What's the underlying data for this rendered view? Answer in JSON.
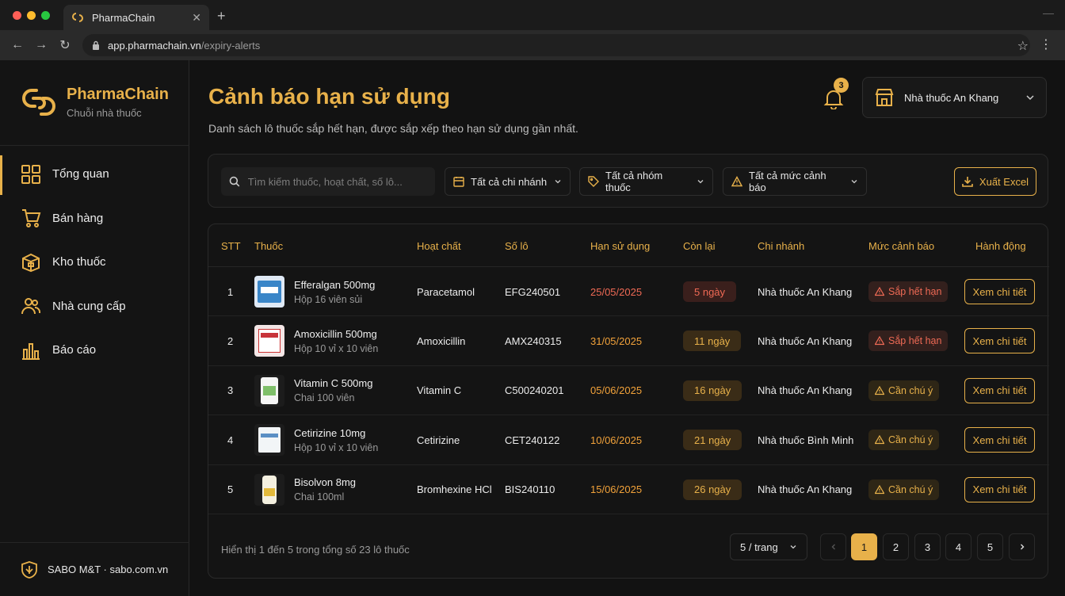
{
  "browser": {
    "tab_title": "PharmaChain",
    "url_host": "app.pharmachain.vn",
    "url_path": "/expiry-alerts"
  },
  "brand": {
    "name": "PharmaChain",
    "subtitle": "Chuỗi nhà thuốc"
  },
  "sidebar": {
    "items": [
      {
        "label": "Tổng quan",
        "icon": "grid-icon",
        "active": true
      },
      {
        "label": "Bán hàng",
        "icon": "cart-icon",
        "active": false
      },
      {
        "label": "Kho thuốc",
        "icon": "box-icon",
        "active": false
      },
      {
        "label": "Nhà cung cấp",
        "icon": "users-icon",
        "active": false
      },
      {
        "label": "Báo cáo",
        "icon": "bar-chart-icon",
        "active": false
      }
    ],
    "footer": "SABO M&T · sabo.com.vn"
  },
  "header": {
    "title": "Cảnh báo hạn sử dụng",
    "subtitle": "Danh sách lô thuốc sắp hết hạn, được sắp xếp theo hạn sử dụng gần nhất.",
    "notification_count": "3",
    "store": "Nhà thuốc An Khang"
  },
  "filters": {
    "search_placeholder": "Tìm kiếm thuốc, hoạt chất, số lô...",
    "branch": "Tất cả chi nhánh",
    "group": "Tất cả nhóm thuốc",
    "level": "Tất cả mức cảnh báo",
    "export": "Xuất Excel"
  },
  "table": {
    "columns": [
      "STT",
      "Thuốc",
      "Hoạt chất",
      "Số lô",
      "Hạn sử dụng",
      "Còn lại",
      "Chi nhánh",
      "Mức cảnh báo",
      "Hành động"
    ],
    "rows": [
      {
        "stt": "1",
        "name": "Efferalgan 500mg",
        "pack": "Hộp 16 viên sủi",
        "ingredient": "Paracetamol",
        "lot": "EFG240501",
        "expiry": "25/05/2025",
        "remaining": "5 ngày",
        "branch": "Nhà thuốc An Khang",
        "level": "Sắp hết hạn",
        "action": "Xem chi tiết"
      },
      {
        "stt": "2",
        "name": "Amoxicillin 500mg",
        "pack": "Hộp 10 vỉ x 10 viên",
        "ingredient": "Amoxicillin",
        "lot": "AMX240315",
        "expiry": "31/05/2025",
        "remaining": "11 ngày",
        "branch": "Nhà thuốc An Khang",
        "level": "Sắp hết hạn",
        "action": "Xem chi tiết"
      },
      {
        "stt": "3",
        "name": "Vitamin C 500mg",
        "pack": "Chai 100 viên",
        "ingredient": "Vitamin C",
        "lot": "C500240201",
        "expiry": "05/06/2025",
        "remaining": "16 ngày",
        "branch": "Nhà thuốc An Khang",
        "level": "Cần chú ý",
        "action": "Xem chi tiết"
      },
      {
        "stt": "4",
        "name": "Cetirizine 10mg",
        "pack": "Hộp 10 vỉ x 10 viên",
        "ingredient": "Cetirizine",
        "lot": "CET240122",
        "expiry": "10/06/2025",
        "remaining": "21 ngày",
        "branch": "Nhà thuốc Bình Minh",
        "level": "Cần chú ý",
        "action": "Xem chi tiết"
      },
      {
        "stt": "5",
        "name": "Bisolvon 8mg",
        "pack": "Chai 100ml",
        "ingredient": "Bromhexine HCl",
        "lot": "BIS240110",
        "expiry": "15/06/2025",
        "remaining": "26 ngày",
        "branch": "Nhà thuốc An Khang",
        "level": "Cần chú ý",
        "action": "Xem chi tiết"
      }
    ]
  },
  "pagination": {
    "info": "Hiển thị 1 đến 5 trong tổng số 23 lô thuốc",
    "page_size": "5 / trang",
    "pages": [
      "1",
      "2",
      "3",
      "4",
      "5"
    ],
    "current": "1"
  },
  "colors": {
    "accent": "#e8b14a",
    "danger": "#f06a55",
    "warning": "#f2a23a",
    "background": "#121212"
  }
}
